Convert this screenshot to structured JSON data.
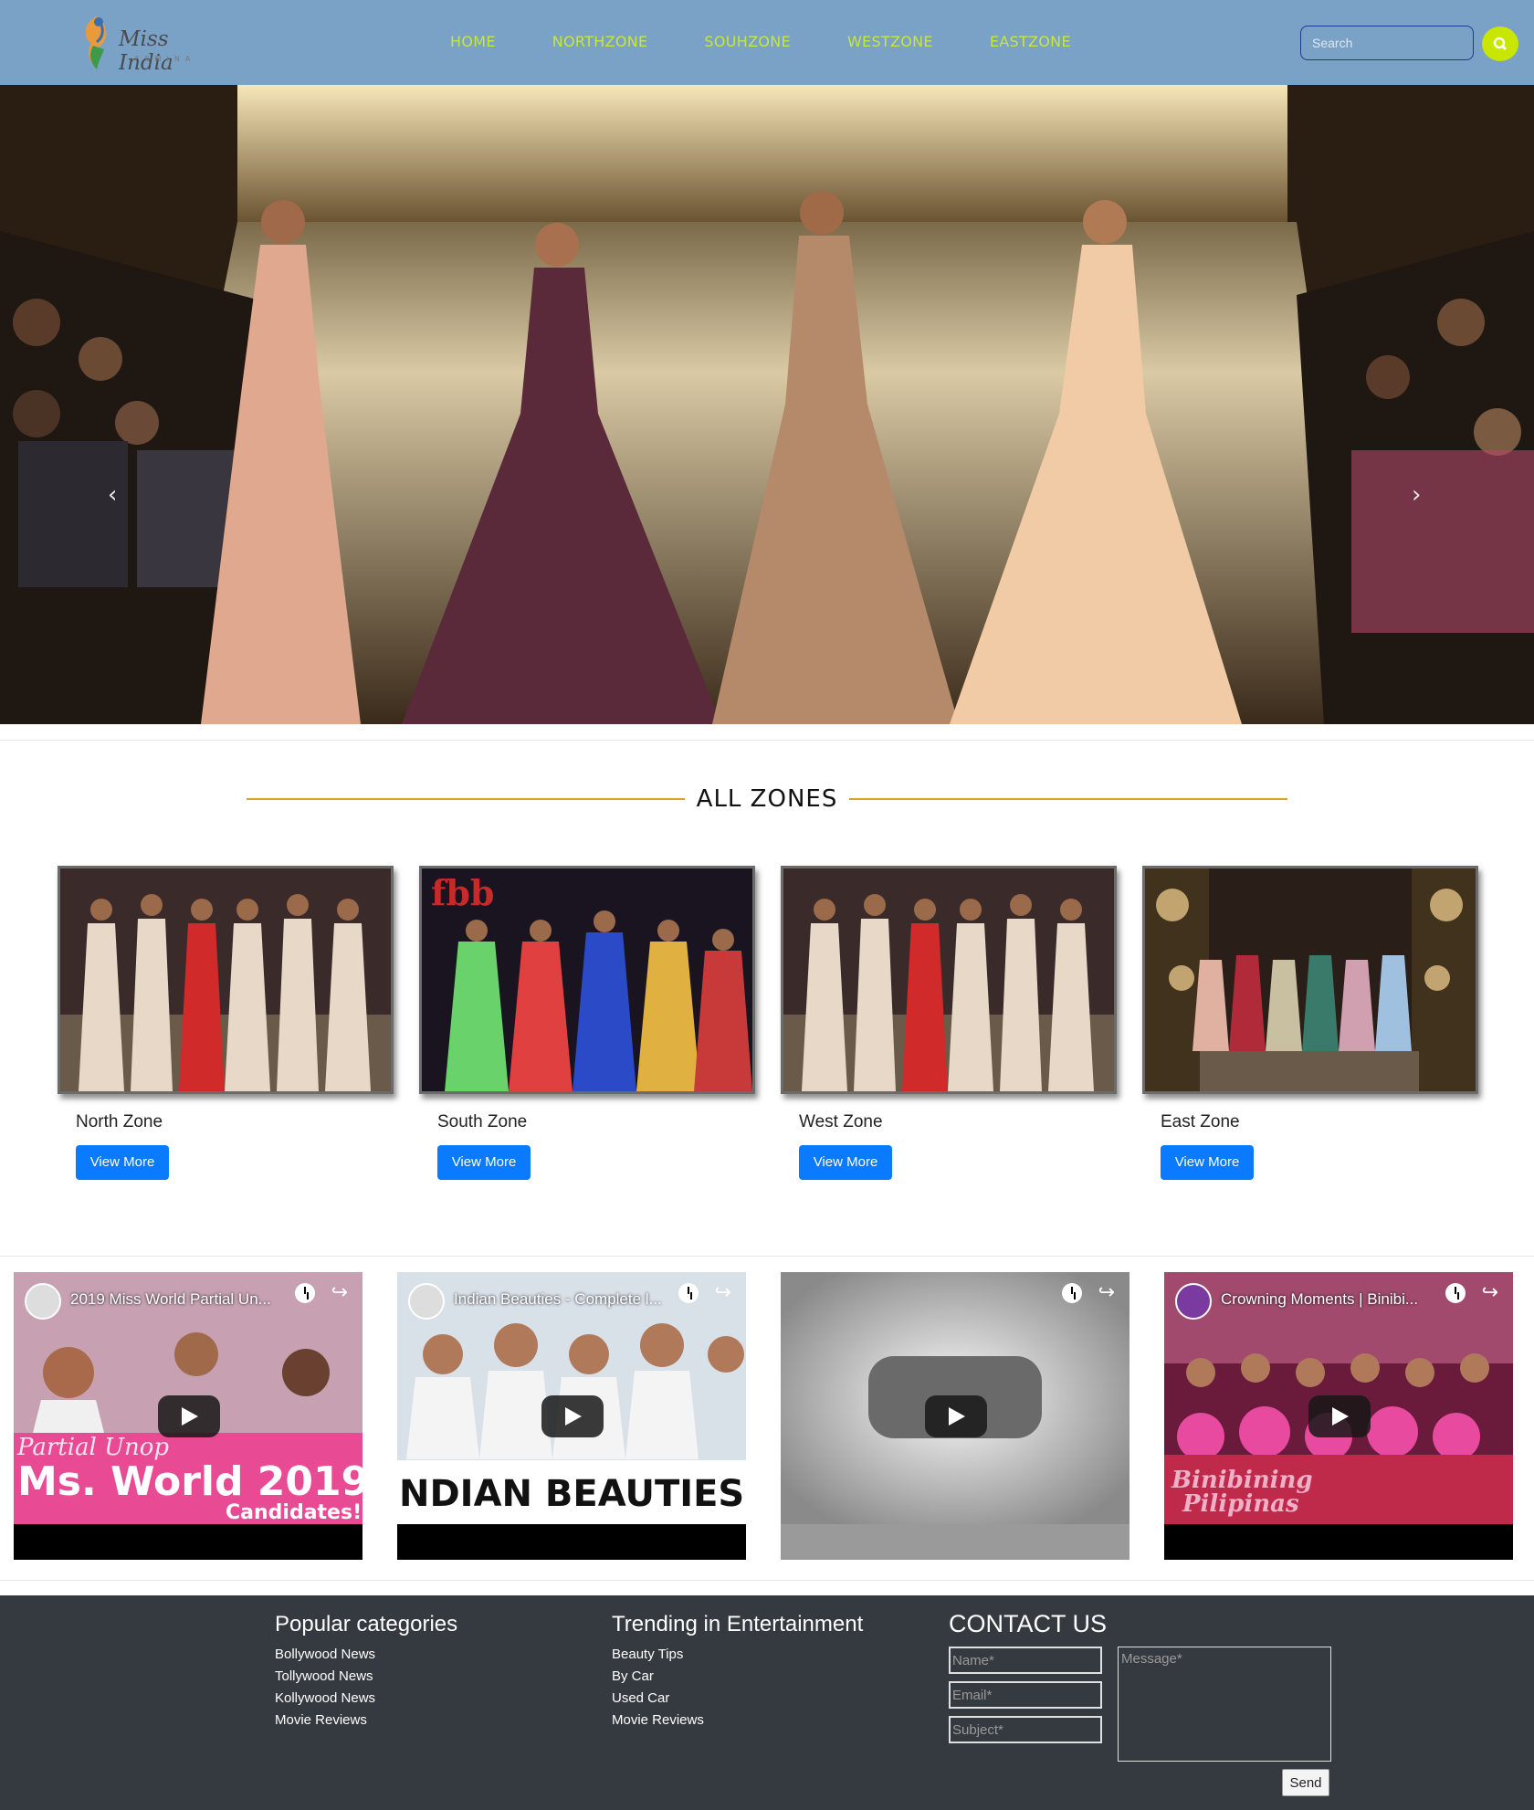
{
  "brand": {
    "logo_text": "Miss India",
    "logo_sub": "FEMINA"
  },
  "nav": {
    "items": [
      "HOME",
      "NORTHZONE",
      "SOUHZONE",
      "WESTZONE",
      "EASTZONE"
    ]
  },
  "search": {
    "placeholder": "Search"
  },
  "hero": {
    "prev": "‹",
    "next": "›"
  },
  "zones": {
    "title": "ALL ZONES",
    "cards": [
      {
        "name": "North Zone",
        "button": "View More"
      },
      {
        "name": "South Zone",
        "button": "View More"
      },
      {
        "name": "West Zone",
        "button": "View More"
      },
      {
        "name": "East Zone",
        "button": "View More"
      }
    ]
  },
  "videos": [
    {
      "title": "2019 Miss World Partial Un..."
    },
    {
      "title": "Indian Beauties - Complete l..."
    },
    {
      "title": ""
    },
    {
      "title": "Crowning Moments | Binibi..."
    }
  ],
  "video_overlays": [
    "Ms. World 2019",
    "Candidates!",
    "NDIAN BEAUTIES"
  ],
  "footer": {
    "popular": {
      "title": "Popular categories",
      "links": [
        "Bollywood News",
        "Tollywood News",
        "Kollywood News",
        "Movie Reviews"
      ]
    },
    "trending": {
      "title": "Trending in Entertainment",
      "links": [
        "Beauty Tips",
        "By Car",
        "Used Car",
        "Movie Reviews"
      ]
    },
    "contact": {
      "title": "CONTACT US",
      "name_ph": "Name*",
      "email_ph": "Email*",
      "subject_ph": "Subject*",
      "message_ph": "Message*",
      "send": "Send"
    }
  },
  "colors": {
    "nav_bg": "#7aa2c6",
    "nav_link": "#c8e63e",
    "accent_line": "#d9a32b",
    "button": "#0a7bff",
    "footer_bg": "#343a40"
  }
}
